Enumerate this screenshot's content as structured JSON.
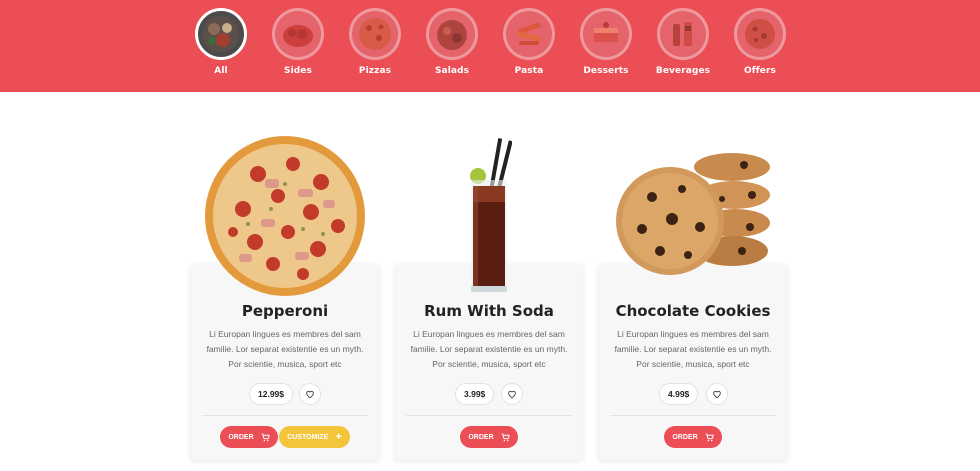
{
  "categories": [
    {
      "label": "All",
      "icon": "all-food-icon",
      "active": true
    },
    {
      "label": "Sides",
      "icon": "sides-icon",
      "active": false
    },
    {
      "label": "Pizzas",
      "icon": "pizza-icon",
      "active": false
    },
    {
      "label": "Salads",
      "icon": "salad-icon",
      "active": false
    },
    {
      "label": "Pasta",
      "icon": "pasta-icon",
      "active": false
    },
    {
      "label": "Desserts",
      "icon": "dessert-icon",
      "active": false
    },
    {
      "label": "Beverages",
      "icon": "beverage-icon",
      "active": false
    },
    {
      "label": "Offers",
      "icon": "offer-icon",
      "active": false
    }
  ],
  "products": [
    {
      "name": "Pepperoni",
      "description": "Li Europan lingues es membres del sam familie. Lor separat existentie es un myth. Por scientie, musica, sport etc",
      "price": "12.99$",
      "order_label": "ORDER",
      "customize_label": "CUSTOMIZE"
    },
    {
      "name": "Rum With Soda",
      "description": "Li Europan lingues es membres del sam familie. Lor separat existentie es un myth. Por scientie, musica, sport etc",
      "price": "3.99$",
      "order_label": "ORDER"
    },
    {
      "name": "Chocolate Cookies",
      "description": "Li Europan lingues es membres del sam familie. Lor separat existentie es un myth. Por scientie, musica, sport etc",
      "price": "4.99$",
      "order_label": "ORDER"
    }
  ],
  "colors": {
    "brand_red": "#ec4e56",
    "customize_yellow": "#f4c43a"
  }
}
